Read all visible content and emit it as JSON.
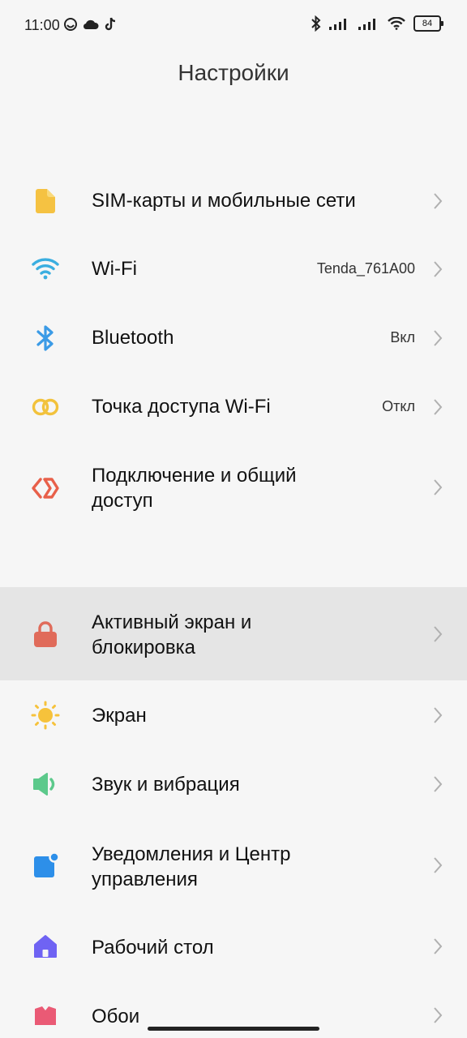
{
  "status_bar": {
    "time": "11:00",
    "battery": "84"
  },
  "header": {
    "title": "Настройки"
  },
  "settings": {
    "items": [
      {
        "label": "SIM-карты и мобильные сети",
        "value": "",
        "icon": "sim-card-icon"
      },
      {
        "label": "Wi-Fi",
        "value": "Tenda_761A00",
        "icon": "wifi-icon"
      },
      {
        "label": "Bluetooth",
        "value": "Вкл",
        "icon": "bluetooth-icon"
      },
      {
        "label": "Точка доступа Wi-Fi",
        "value": "Откл",
        "icon": "hotspot-icon"
      },
      {
        "label": "Подключение и общий доступ",
        "value": "",
        "icon": "connection-sharing-icon"
      },
      {
        "label": "Активный экран и блокировка",
        "value": "",
        "icon": "lock-icon"
      },
      {
        "label": "Экран",
        "value": "",
        "icon": "brightness-icon"
      },
      {
        "label": "Звук и вибрация",
        "value": "",
        "icon": "speaker-icon"
      },
      {
        "label": "Уведомления и Центр управления",
        "value": "",
        "icon": "notifications-icon"
      },
      {
        "label": "Рабочий стол",
        "value": "",
        "icon": "home-icon"
      },
      {
        "label": "Обои",
        "value": "",
        "icon": "wallpaper-icon"
      }
    ]
  },
  "colors": {
    "sim": "#f5c242",
    "wifi": "#3aaee0",
    "bluetooth": "#3b9be6",
    "hotspot": "#f2c23c",
    "sharing": "#e8604a",
    "lock": "#e06b5a",
    "display": "#f6c23b",
    "sound": "#5cc98b",
    "notifications": "#2d8fe9",
    "home": "#6f63f3",
    "wallpaper": "#ea5a75"
  }
}
